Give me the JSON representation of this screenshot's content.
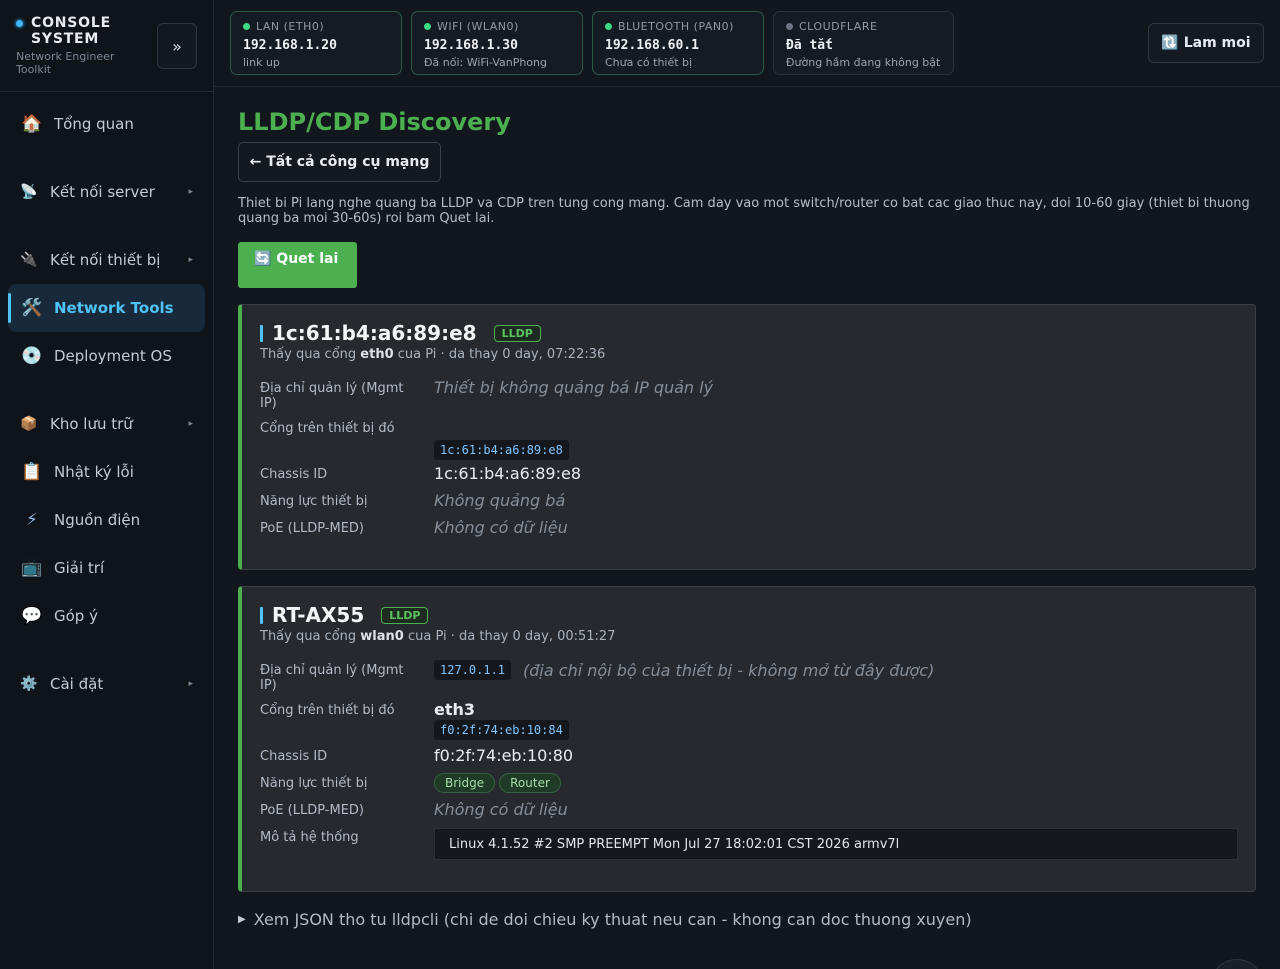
{
  "app": {
    "title": "CONSOLE SYSTEM",
    "subtitle": "Network Engineer Toolkit",
    "collapse_label": "»"
  },
  "sidebar": {
    "items": [
      {
        "icon": "🏠",
        "icon_name": "home-icon",
        "label": "Tổng quan",
        "has_submenu": false
      },
      {
        "icon": "📡",
        "icon_name": "satellite-icon",
        "label": "Kết nối server",
        "has_submenu": true
      },
      {
        "icon": "🔌",
        "icon_name": "plug-icon",
        "label": "Kết nối thiết bị",
        "has_submenu": true
      },
      {
        "icon": "🛠️",
        "icon_name": "tools-icon",
        "label": "Network Tools",
        "has_submenu": false,
        "active": true
      },
      {
        "icon": "💿",
        "icon_name": "disc-icon",
        "label": "Deployment OS",
        "has_submenu": false
      },
      {
        "icon": "📦",
        "icon_name": "package-icon",
        "label": "Kho lưu trữ",
        "has_submenu": true
      },
      {
        "icon": "📋",
        "icon_name": "clipboard-icon",
        "label": "Nhật ký lỗi",
        "has_submenu": false
      },
      {
        "icon": "⚡",
        "icon_name": "lightning-icon",
        "label": "Nguồn điện",
        "has_submenu": false
      },
      {
        "icon": "📺",
        "icon_name": "tv-icon",
        "label": "Giải trí",
        "has_submenu": false
      },
      {
        "icon": "💬",
        "icon_name": "speech-bubble-icon",
        "label": "Góp ý",
        "has_submenu": false
      },
      {
        "icon": "⚙️",
        "icon_name": "gear-icon",
        "label": "Cài đặt",
        "has_submenu": true
      }
    ],
    "submenu_arrow": "▸"
  },
  "topbar": {
    "interfaces": [
      {
        "label": "LAN (ETH0)",
        "value": "192.168.1.20",
        "sub": "link up",
        "status": "up"
      },
      {
        "label": "WIFI (WLAN0)",
        "value": "192.168.1.30",
        "sub": "Đã nối: WiFi-VanPhong",
        "status": "up"
      },
      {
        "label": "BLUETOOTH (PAN0)",
        "value": "192.168.60.1",
        "sub": "Chưa có thiết bị",
        "status": "up"
      },
      {
        "label": "CLOUDFLARE",
        "value": "Đã tắt",
        "sub": "Đường hầm đang không bật",
        "status": "off"
      }
    ],
    "refresh_label": "🔃 Lam moi"
  },
  "page": {
    "title": "LLDP/CDP Discovery",
    "back_label": "← Tất cả công cụ mạng",
    "description": "Thiet bi Pi lang nghe quang ba LLDP va CDP tren tung cong mang. Cam day vao mot switch/router co bat cac giao thuc nay, doi 10-60 giay (thiet bi thuong quang ba moi 30-60s) roi bam Quet lai.",
    "scan_label": "🔄 Quet lai",
    "json_toggle": "Xem JSON tho tu lldpcli (chi de doi chieu ky thuat neu can - khong can doc thuong xuyen)"
  },
  "labels": {
    "mgmt_ip": "Địa chỉ quản lý (Mgmt IP)",
    "port": "Cổng trên thiết bị đó",
    "chassis": "Chassis ID",
    "capabilities": "Năng lực thiết bị",
    "poe": "PoE (LLDP-MED)",
    "sysdesc": "Mô tả hệ thống"
  },
  "devices": [
    {
      "name": "1c:61:b4:a6:89:e8",
      "protocol": "LLDP",
      "seen_prefix": "Thấy qua cổng ",
      "iface": "eth0",
      "seen_suffix": " cua Pi · da thay 0 day, 07:22:36",
      "mgmt_ip_text": "Thiết bị không quảng bá IP quản lý",
      "port_mac": "1c:61:b4:a6:89:e8",
      "chassis_id": "1c:61:b4:a6:89:e8",
      "capabilities_text": "Không quảng bá",
      "poe_text": "Không có dữ liệu"
    },
    {
      "name": "RT-AX55",
      "protocol": "LLDP",
      "seen_prefix": "Thấy qua cổng ",
      "iface": "wlan0",
      "seen_suffix": " cua Pi · da thay 0 day, 00:51:27",
      "mgmt_ip": "127.0.1.1",
      "mgmt_ip_note": "(địa chỉ nội bộ của thiết bị - không mở từ đây được)",
      "port_name": "eth3",
      "port_mac": "f0:2f:74:eb:10:84",
      "chassis_id": "f0:2f:74:eb:10:80",
      "capabilities": [
        "Bridge",
        "Router"
      ],
      "poe_text": "Không có dữ liệu",
      "system_description": "Linux 4.1.52 #2 SMP PREEMPT Mon Jul 27 18:02:01 CST 2026 armv7l"
    }
  ],
  "colors": {
    "accent_green": "#4caf50",
    "accent_blue": "#4fc3f7",
    "status_up": "#3ddc84",
    "status_off": "#6b7480"
  }
}
